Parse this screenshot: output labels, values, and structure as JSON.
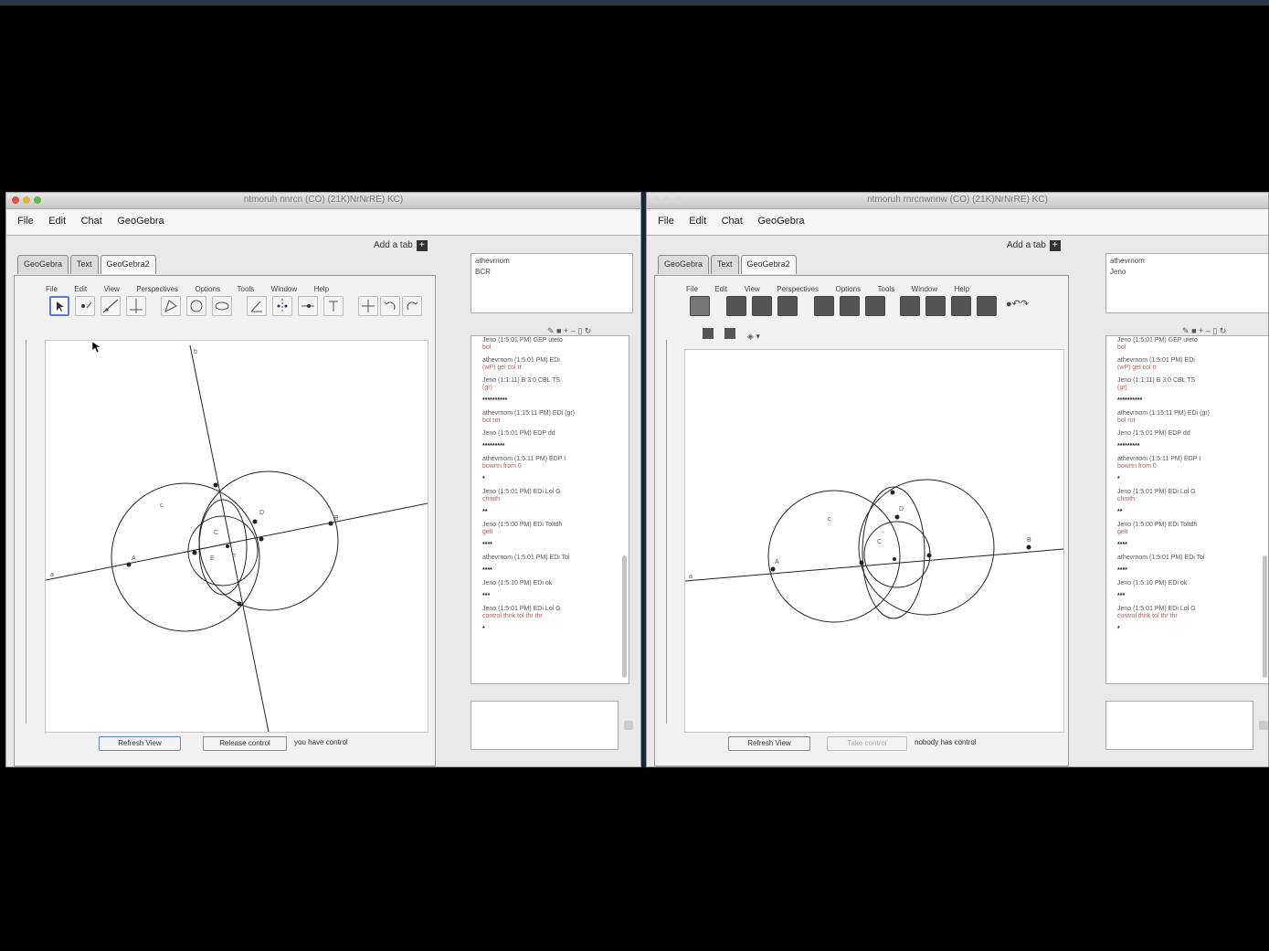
{
  "left_window": {
    "title": "ntmoruh nnrcn (CO)  (21K)NrNrRE)  KC)",
    "menu": [
      "File",
      "Edit",
      "Chat",
      "GeoGebra"
    ],
    "add_tab": "Add a tab",
    "tabs": [
      "GeoGebra",
      "Text",
      "GeoGebra2"
    ],
    "gg_menu": [
      "File",
      "Edit",
      "View",
      "Perspectives",
      "Options",
      "Tools",
      "Window",
      "Help"
    ],
    "buttons": [
      "Refresh View",
      "Release control"
    ],
    "status": "you have control",
    "info_lines": [
      "athevrnom",
      "BCR"
    ],
    "chat": [
      {
        "a": "Jeno (1:5:01 PM) GEP  uteto",
        "b": "bol"
      },
      {
        "a": "athevrnom (1:5:01 PM) EDi",
        "b": "(wP) gel  col tr"
      },
      {
        "a": "Jeno (1:1:11) B 3:0 CBL  TS",
        "b": "(gr)"
      },
      {
        "a": "**********",
        "b": ""
      },
      {
        "a": "athevrnom (1:15:11 PM) EDi  (gr)",
        "b": "bol rot"
      },
      {
        "a": "Jeno (1:5:01 PM) EDP  dd",
        "b": ""
      },
      {
        "a": "*********",
        "b": ""
      },
      {
        "a": "athevrnom (1:5:11 PM) EDP  I",
        "b": "bowrtn from  0"
      },
      {
        "a": "*",
        "b": ""
      },
      {
        "a": "Jeno (1:5:01 PM) EDi  Lol G",
        "b": "chmth"
      },
      {
        "a": "**",
        "b": ""
      },
      {
        "a": "Jeno (1:5:00 PM) EDi  Toltdh",
        "b": "gelt"
      },
      {
        "a": "****",
        "b": ""
      },
      {
        "a": "athevrnom (1:5:01 PM) EDi  Tol",
        "b": ""
      },
      {
        "a": "****",
        "b": ""
      },
      {
        "a": "Jeno (1:5:10 PM) EDi  ok",
        "b": ""
      },
      {
        "a": "***",
        "b": ""
      },
      {
        "a": "Jeno (1:5:01 PM) EDi  Lol G",
        "b": "control  thnk  tol  thr  thr"
      },
      {
        "a": "*",
        "b": ""
      }
    ]
  },
  "right_window": {
    "title": "ntmoruh rnrcnwnnw (CO)  (21K)NrNrRE)  KC)",
    "menu": [
      "File",
      "Edit",
      "Chat",
      "GeoGebra"
    ],
    "add_tab": "Add a tab",
    "tabs": [
      "GeoGebra",
      "Text",
      "GeoGebra2"
    ],
    "gg_menu": [
      "File",
      "Edit",
      "View",
      "Perspectives",
      "Options",
      "Tools",
      "Window",
      "Help"
    ],
    "buttons": [
      "Refresh View",
      "Take control"
    ],
    "status": "nobody has control",
    "info_lines": [
      "athevrnom",
      "Jeno"
    ],
    "chat": [
      {
        "a": "Jeno (1:5:01 PM) GEP  uteto",
        "b": "bol"
      },
      {
        "a": "athevrnom (1:5:01 PM) EDi",
        "b": "(wP) gel  col tr"
      },
      {
        "a": "Jeno (1:1:11) B 3:0 CBL  TS",
        "b": "(gr)"
      },
      {
        "a": "**********",
        "b": ""
      },
      {
        "a": "athevrnom (1:15:11 PM) EDi  (gr)",
        "b": "bol rot"
      },
      {
        "a": "Jeno (1:5:01 PM) EDP  dd",
        "b": ""
      },
      {
        "a": "*********",
        "b": ""
      },
      {
        "a": "athevrnom (1:5:11 PM) EDP  I",
        "b": "bowrtn from  0"
      },
      {
        "a": "*",
        "b": ""
      },
      {
        "a": "Jeno (1:5:01 PM) EDi  Lol G",
        "b": "chmth"
      },
      {
        "a": "**",
        "b": ""
      },
      {
        "a": "Jeno (1:5:00 PM) EDi  Toltdh",
        "b": "gelt"
      },
      {
        "a": "****",
        "b": ""
      },
      {
        "a": "athevrnom (1:5:01 PM) EDi  Tol",
        "b": ""
      },
      {
        "a": "****",
        "b": ""
      },
      {
        "a": "Jeno (1:5:10 PM) EDi  ok",
        "b": ""
      },
      {
        "a": "***",
        "b": ""
      },
      {
        "a": "Jeno (1:5:01 PM) EDi  Lol G",
        "b": "control  thnk  tol  thr  thr"
      },
      {
        "a": "*",
        "b": ""
      }
    ]
  },
  "colors": {
    "selected_tool": "#5a7bd6",
    "chat_secondary": "#a86060"
  }
}
